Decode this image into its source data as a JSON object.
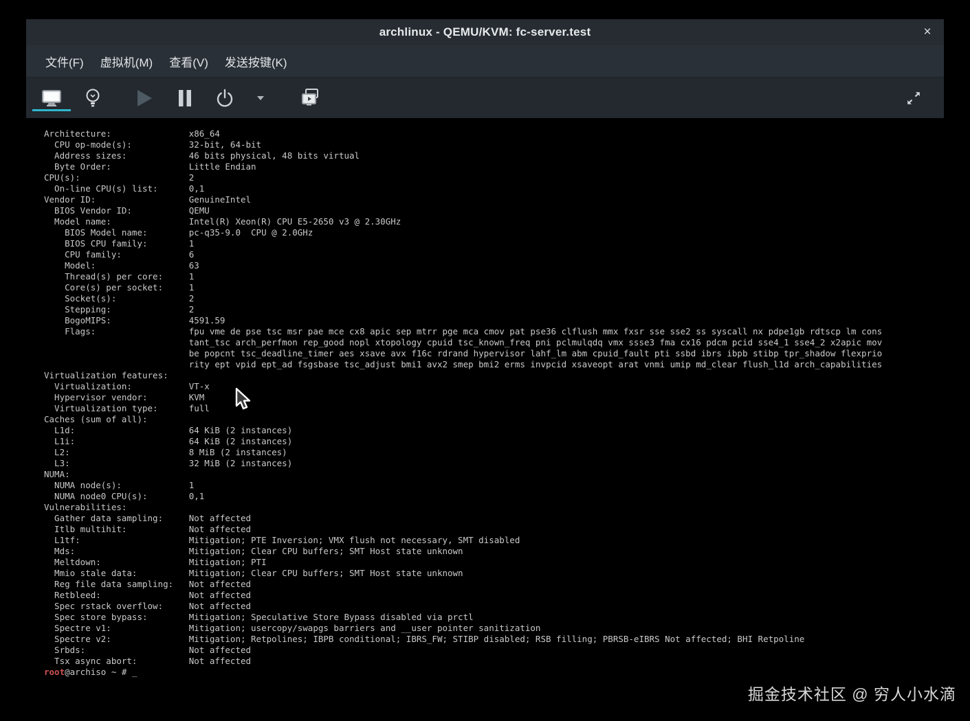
{
  "window": {
    "title": "archlinux - QEMU/KVM: fc-server.test",
    "close_glyph": "×"
  },
  "menu": {
    "items": [
      {
        "label": "文件(F)"
      },
      {
        "label": "虚拟机(M)"
      },
      {
        "label": "查看(V)"
      },
      {
        "label": "发送按键(K)"
      }
    ]
  },
  "toolbar": {
    "icons": [
      {
        "name": "console-display-icon",
        "active": true
      },
      {
        "name": "lightbulb-details-icon",
        "active": false
      },
      {
        "name": "play-icon",
        "active": false
      },
      {
        "name": "pause-icon",
        "active": false
      },
      {
        "name": "power-icon",
        "active": false
      },
      {
        "name": "chevron-down-icon",
        "active": false
      },
      {
        "name": "virtual-displays-icon",
        "active": false
      },
      {
        "name": "fullscreen-icon",
        "active": false
      }
    ],
    "accent_color": "#2fb7cf"
  },
  "terminal": {
    "value_column": 28,
    "fg_color": "#c9c9c9",
    "bg_color": "#000000",
    "rows": [
      {
        "i": 0,
        "k": "Architecture:",
        "v": "x86_64"
      },
      {
        "i": 2,
        "k": "CPU op-mode(s):",
        "v": "32-bit, 64-bit"
      },
      {
        "i": 2,
        "k": "Address sizes:",
        "v": "46 bits physical, 48 bits virtual"
      },
      {
        "i": 2,
        "k": "Byte Order:",
        "v": "Little Endian"
      },
      {
        "i": 0,
        "k": "CPU(s):",
        "v": "2"
      },
      {
        "i": 2,
        "k": "On-line CPU(s) list:",
        "v": "0,1"
      },
      {
        "i": 0,
        "k": "Vendor ID:",
        "v": "GenuineIntel"
      },
      {
        "i": 2,
        "k": "BIOS Vendor ID:",
        "v": "QEMU"
      },
      {
        "i": 2,
        "k": "Model name:",
        "v": "Intel(R) Xeon(R) CPU E5-2650 v3 @ 2.30GHz"
      },
      {
        "i": 4,
        "k": "BIOS Model name:",
        "v": "pc-q35-9.0  CPU @ 2.0GHz"
      },
      {
        "i": 4,
        "k": "BIOS CPU family:",
        "v": "1"
      },
      {
        "i": 4,
        "k": "CPU family:",
        "v": "6"
      },
      {
        "i": 4,
        "k": "Model:",
        "v": "63"
      },
      {
        "i": 4,
        "k": "Thread(s) per core:",
        "v": "1"
      },
      {
        "i": 4,
        "k": "Core(s) per socket:",
        "v": "1"
      },
      {
        "i": 4,
        "k": "Socket(s):",
        "v": "2"
      },
      {
        "i": 4,
        "k": "Stepping:",
        "v": "2"
      },
      {
        "i": 4,
        "k": "BogoMIPS:",
        "v": "4591.59"
      },
      {
        "i": 4,
        "k": "Flags:",
        "v": "fpu vme de pse tsc msr pae mce cx8 apic sep mtrr pge mca cmov pat pse36 clflush mmx fxsr sse sse2 ss syscall nx pdpe1gb rdtscp lm cons"
      },
      {
        "i": 0,
        "k": "",
        "v": "tant_tsc arch_perfmon rep_good nopl xtopology cpuid tsc_known_freq pni pclmulqdq vmx ssse3 fma cx16 pdcm pcid sse4_1 sse4_2 x2apic mov"
      },
      {
        "i": 0,
        "k": "",
        "v": "be popcnt tsc_deadline_timer aes xsave avx f16c rdrand hypervisor lahf_lm abm cpuid_fault pti ssbd ibrs ibpb stibp tpr_shadow flexprio"
      },
      {
        "i": 0,
        "k": "",
        "v": "rity ept vpid ept_ad fsgsbase tsc_adjust bmi1 avx2 smep bmi2 erms invpcid xsaveopt arat vnmi umip md_clear flush_l1d arch_capabilities"
      },
      {
        "i": 0,
        "k": "Virtualization features:",
        "v": ""
      },
      {
        "i": 2,
        "k": "Virtualization:",
        "v": "VT-x"
      },
      {
        "i": 2,
        "k": "Hypervisor vendor:",
        "v": "KVM"
      },
      {
        "i": 2,
        "k": "Virtualization type:",
        "v": "full"
      },
      {
        "i": 0,
        "k": "Caches (sum of all):",
        "v": ""
      },
      {
        "i": 2,
        "k": "L1d:",
        "v": "64 KiB (2 instances)"
      },
      {
        "i": 2,
        "k": "L1i:",
        "v": "64 KiB (2 instances)"
      },
      {
        "i": 2,
        "k": "L2:",
        "v": "8 MiB (2 instances)"
      },
      {
        "i": 2,
        "k": "L3:",
        "v": "32 MiB (2 instances)"
      },
      {
        "i": 0,
        "k": "NUMA:",
        "v": ""
      },
      {
        "i": 2,
        "k": "NUMA node(s):",
        "v": "1"
      },
      {
        "i": 2,
        "k": "NUMA node0 CPU(s):",
        "v": "0,1"
      },
      {
        "i": 0,
        "k": "Vulnerabilities:",
        "v": ""
      },
      {
        "i": 2,
        "k": "Gather data sampling:",
        "v": "Not affected"
      },
      {
        "i": 2,
        "k": "Itlb multihit:",
        "v": "Not affected"
      },
      {
        "i": 2,
        "k": "L1tf:",
        "v": "Mitigation; PTE Inversion; VMX flush not necessary, SMT disabled"
      },
      {
        "i": 2,
        "k": "Mds:",
        "v": "Mitigation; Clear CPU buffers; SMT Host state unknown"
      },
      {
        "i": 2,
        "k": "Meltdown:",
        "v": "Mitigation; PTI"
      },
      {
        "i": 2,
        "k": "Mmio stale data:",
        "v": "Mitigation; Clear CPU buffers; SMT Host state unknown"
      },
      {
        "i": 2,
        "k": "Reg file data sampling:",
        "v": "Not affected"
      },
      {
        "i": 2,
        "k": "Retbleed:",
        "v": "Not affected"
      },
      {
        "i": 2,
        "k": "Spec rstack overflow:",
        "v": "Not affected"
      },
      {
        "i": 2,
        "k": "Spec store bypass:",
        "v": "Mitigation; Speculative Store Bypass disabled via prctl"
      },
      {
        "i": 2,
        "k": "Spectre v1:",
        "v": "Mitigation; usercopy/swapgs barriers and __user pointer sanitization"
      },
      {
        "i": 2,
        "k": "Spectre v2:",
        "v": "Mitigation; Retpolines; IBPB conditional; IBRS_FW; STIBP disabled; RSB filling; PBRSB-eIBRS Not affected; BHI Retpoline"
      },
      {
        "i": 2,
        "k": "Srbds:",
        "v": "Not affected"
      },
      {
        "i": 2,
        "k": "Tsx async abort:",
        "v": "Not affected"
      }
    ],
    "prompt": {
      "user": "root",
      "host": "@archiso",
      "suffix": " ~ # ",
      "cursor": "_",
      "user_color": "#cd5152"
    }
  },
  "watermark": {
    "text": "掘金技术社区 @ 穷人小水滴"
  }
}
